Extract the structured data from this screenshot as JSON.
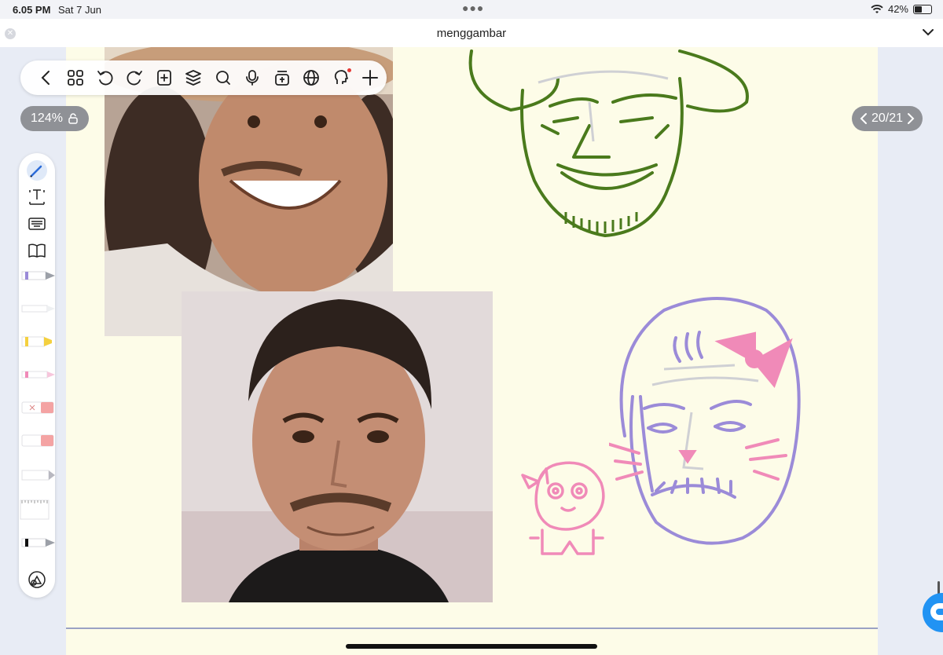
{
  "status_bar": {
    "time": "6.05 PM",
    "date": "Sat 7 Jun",
    "battery_text": "42%",
    "battery_level": 0.42
  },
  "document": {
    "title": "menggambar"
  },
  "toolbar": {
    "buttons": [
      "back",
      "thumbnails",
      "undo",
      "redo",
      "add-page",
      "layers",
      "search",
      "microphone",
      "media",
      "web",
      "ai-assistant",
      "add"
    ]
  },
  "zoom": {
    "label": "124%"
  },
  "pagination": {
    "label": "20/21",
    "current": 20,
    "total": 21
  },
  "palette": {
    "tools": [
      "pen",
      "text-box",
      "keyboard",
      "reader",
      "fountain-pen",
      "ballpoint",
      "highlighter",
      "pink-pen",
      "eraser",
      "pink-eraser",
      "pencil",
      "ruler",
      "black-fountain-pen",
      "shapes"
    ]
  },
  "colors": {
    "green_sketch": "#4a7a1c",
    "purple_sketch": "#9b8bd8",
    "pink_sketch": "#f08ab8",
    "canvas": "#fdfce8",
    "accent": "#2193f3"
  }
}
